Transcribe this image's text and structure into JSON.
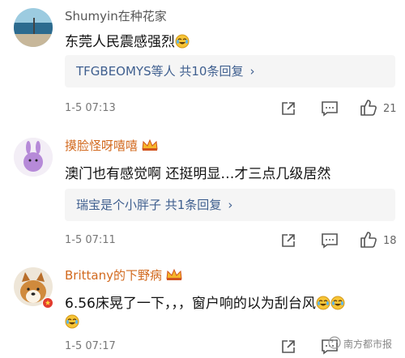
{
  "comments": [
    {
      "username": "Shumyin在种花家",
      "text": "东莞人民震感强烈",
      "reply_summary": "TFGBEOMYS等人  共10条回复",
      "time": "1-5 07:13",
      "likes": "21",
      "emoji": "laugh-cry-emoji"
    },
    {
      "username": "摸脸怪呀嘻嘻",
      "text": "澳门也有感觉啊 还挺明显…才三点几级居然",
      "reply_summary": "瑞宝是个小胖子  共1条回复",
      "time": "1-5 07:11",
      "likes": "18"
    },
    {
      "username": "Brittany的下野病",
      "text": "6.56床晃了一下，，，窗户响的以为刮台风",
      "time": "1-5 07:17",
      "likes": ""
    }
  ],
  "watermark": "南方都市报",
  "icons": [
    "share-icon",
    "comment-icon",
    "like-icon",
    "chevron-right-icon",
    "laugh-cry-emoji",
    "vip-crown-badge"
  ],
  "colors": {
    "username_vip": "#d2691e",
    "reply_link": "#3f5f8f",
    "reply_bg": "#f5f5f5"
  }
}
